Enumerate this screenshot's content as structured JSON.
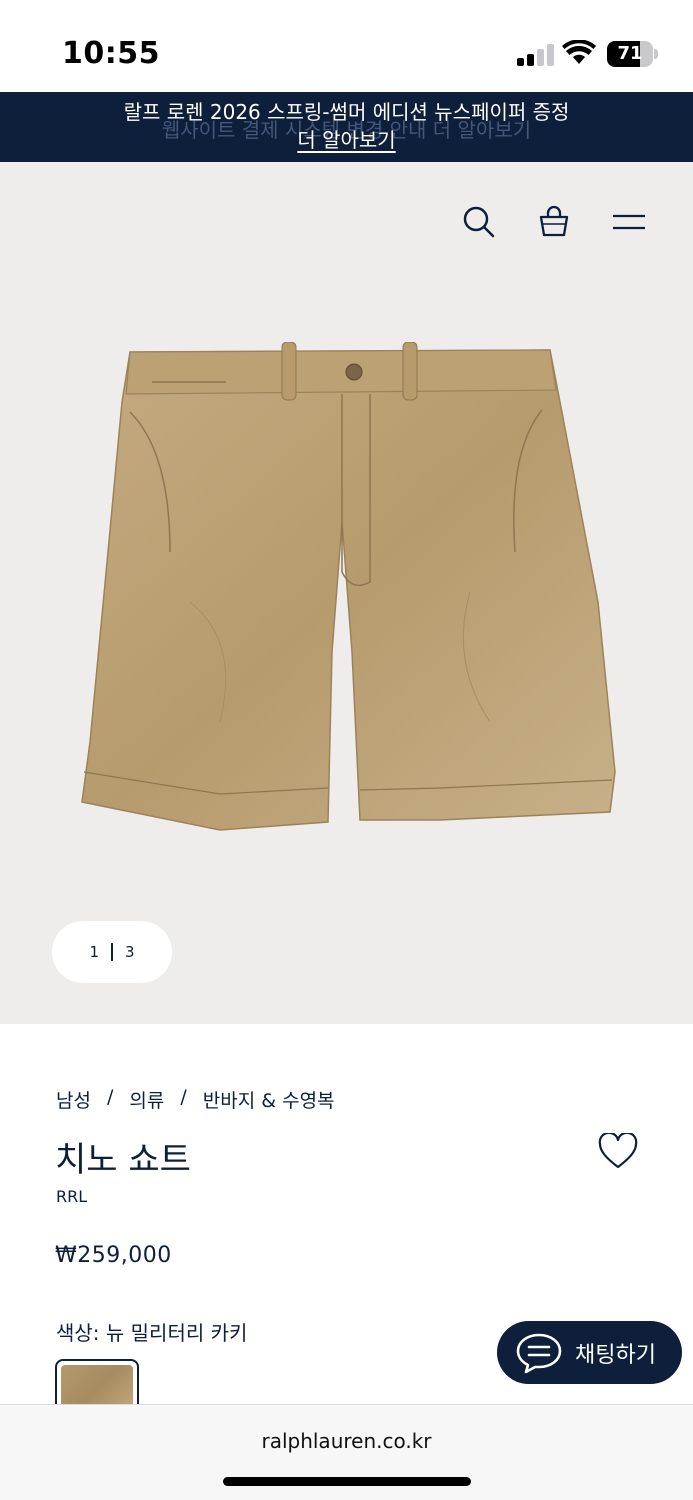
{
  "status_bar": {
    "time": "10:55",
    "battery": "71",
    "battery_level": 0.71
  },
  "promo": {
    "line": "랄프 로렌 2026 스프링-썸머 에디션 뉴스페이퍼 증정",
    "link": "더 알아보기",
    "ghost": "웹사이트 결제 시스템 변경 안내   더 알아보기"
  },
  "header": {
    "icons": [
      "search-icon",
      "shopping-bag-icon",
      "menu-icon"
    ]
  },
  "gallery": {
    "current": "1",
    "total": "3"
  },
  "product": {
    "breadcrumb": [
      "남성",
      "의류",
      "반바지 & 수영복"
    ],
    "separator": "/",
    "title": "치노 쇼트",
    "brand": "RRL",
    "price": "₩259,000",
    "color_label": "색상: 뉴 밀리터리 카키",
    "colors": {
      "navy": "#0d1f3a",
      "khaki": "#b49a6d",
      "background": "#efedec"
    }
  },
  "chat": {
    "label": "채팅하기"
  },
  "browser": {
    "url": "ralphlauren.co.kr"
  }
}
